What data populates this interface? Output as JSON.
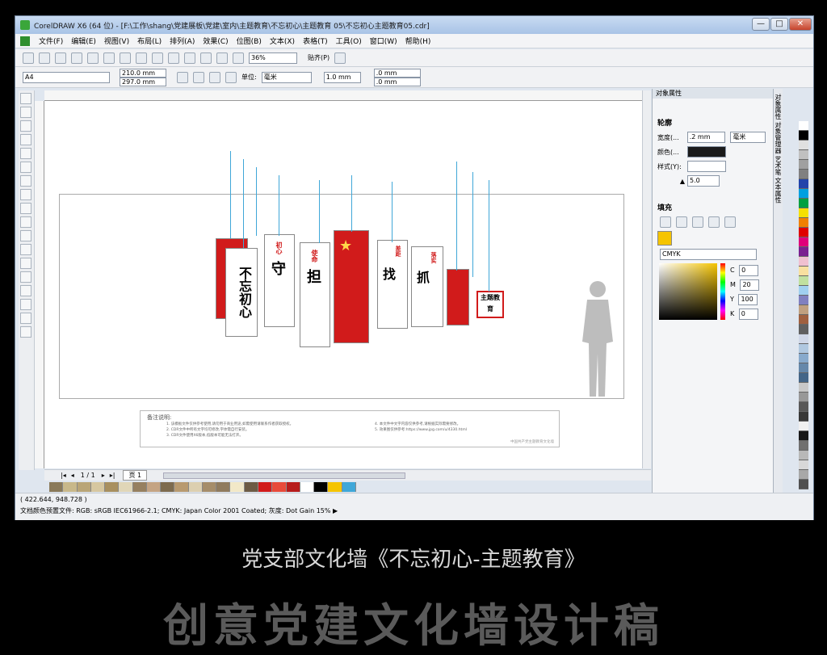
{
  "window": {
    "title": "CorelDRAW X6 (64 位) - [F:\\工作\\shang\\党建展板\\党建\\室内\\主题教育\\不忘初心\\主题教育 05\\不忘初心主题教育05.cdr]",
    "controls": [
      "—",
      "□",
      "✕"
    ]
  },
  "menu": [
    "文件(F)",
    "编辑(E)",
    "视图(V)",
    "布局(L)",
    "排列(A)",
    "效果(C)",
    "位图(B)",
    "文本(X)",
    "表格(T)",
    "工具(O)",
    "窗口(W)",
    "帮助(H)"
  ],
  "toolbar": {
    "zoom": "36%",
    "snap": "贴齐(P)"
  },
  "propbar": {
    "page_size": "A4",
    "width": "210.0 mm",
    "height": "297.0 mm",
    "unit_label": "单位:",
    "unit": "毫米",
    "nudge": "1.0 mm",
    "dup_x": ".0 mm",
    "dup_y": ".0 mm"
  },
  "page_nav": {
    "counter": "1 / 1",
    "page_tab": "页 1"
  },
  "status": {
    "coords": "( 422.644, 948.728 )",
    "profile": "文档颜色预置文件: RGB: sRGB IEC61966-2.1; CMYK: Japan Color 2001 Coated; 灰度: Dot Gain 15% ▶"
  },
  "docker": {
    "title": "对象属性",
    "outline_section": "轮廓",
    "width_label": "宽度(...",
    "width_value": ".2 mm",
    "width_unit": "毫米",
    "color_label": "颜色(...",
    "style_label": "样式(Y):",
    "miter_value": "5.0",
    "fill_section": "填充",
    "color_model": "CMYK",
    "c": "0",
    "m": "20",
    "y": "100",
    "k": "0",
    "c_label": "C",
    "m_label": "M",
    "y_label": "Y",
    "k_label": "K"
  },
  "side_tabs": "对象属性 对象管理器 艺术笔 文本属性",
  "design": {
    "p1": "不忘初心",
    "p2": "初心",
    "p2b": "守",
    "p3": "使命",
    "p3b": "担",
    "p5": "找",
    "p5a": "差距",
    "p6": "抓",
    "p6a": "落实",
    "badge": "主题教育",
    "notes_title": "备注说明:",
    "note_lines": [
      "1. 该模板文件仅供参考使用,请勿用于商业用途,如需使用请联系作者获取授权。",
      "2. CDR文件中所有文字均可修改,字体需自行安装。",
      "3. CDR文件使用X6版本,低版本可能无法打开。",
      "4. 本文件中文字内容仅供参考,请根据实际需要修改。",
      "5. 效果图仅供参考:https://www.jpg.com/u/4330.html"
    ],
    "notes_footer": "中国共产党主题教育文化墙"
  },
  "captions": {
    "line1": "党支部文化墙《不忘初心-主题教育》",
    "line2": "创意党建文化墙设计稿"
  },
  "colors": {
    "accent_red": "#d11b1b",
    "leader_blue": "#3fa7d8",
    "fill_yellow": "#f5c400"
  }
}
